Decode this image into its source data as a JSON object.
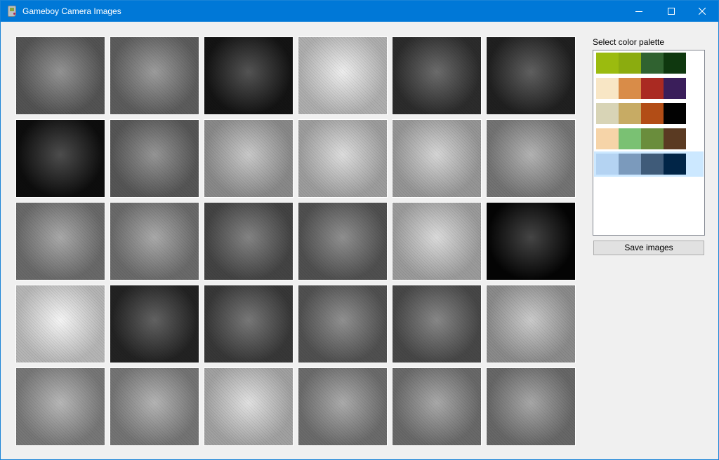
{
  "window": {
    "title": "Gameboy Camera Images"
  },
  "palette_panel": {
    "label": "Select color palette",
    "palettes": [
      {
        "colors": [
          "#9bbb0f",
          "#8bac0f",
          "#306230",
          "#0f380f"
        ],
        "selected": false
      },
      {
        "colors": [
          "#f8e6c5",
          "#d98c48",
          "#aa2a22",
          "#3a1e5a"
        ],
        "selected": false
      },
      {
        "colors": [
          "#d8d4b6",
          "#c7ab64",
          "#b24d16",
          "#020202"
        ],
        "selected": false
      },
      {
        "colors": [
          "#f6d4a8",
          "#7ac173",
          "#6a8d3c",
          "#5a3a22"
        ],
        "selected": false
      },
      {
        "colors": [
          "#b4d3f2",
          "#7b9abc",
          "#3f5b79",
          "#012547"
        ],
        "selected": true
      }
    ],
    "save_label": "Save images"
  },
  "images": [
    {
      "name": "tv-remote",
      "tone": "#6f6f6f"
    },
    {
      "name": "tv-empty",
      "tone": "#7b7b7b"
    },
    {
      "name": "graphic-stripes",
      "tone": "#1a1a1a"
    },
    {
      "name": "high-contrast-shape",
      "tone": "#e8e8e8"
    },
    {
      "name": "hallway-dark",
      "tone": "#3a3a3a"
    },
    {
      "name": "dark-door",
      "tone": "#2a2a2a"
    },
    {
      "name": "dark-scene",
      "tone": "#111111"
    },
    {
      "name": "tv-remote-2",
      "tone": "#727272"
    },
    {
      "name": "paper-drawing",
      "tone": "#b7b7b7"
    },
    {
      "name": "child-hallway",
      "tone": "#d2d2d2"
    },
    {
      "name": "child-arms-up",
      "tone": "#c8c8c8"
    },
    {
      "name": "boy-portrait",
      "tone": "#9a9a9a"
    },
    {
      "name": "woman-smiling",
      "tone": "#8c8c8c"
    },
    {
      "name": "boy-portrait-2",
      "tone": "#8d8d8d"
    },
    {
      "name": "gradient-curve",
      "tone": "#5a5a5a"
    },
    {
      "name": "child-closeup",
      "tone": "#6a6a6a"
    },
    {
      "name": "cables-toy",
      "tone": "#cfcfcf"
    },
    {
      "name": "black-noise",
      "tone": "#060606"
    },
    {
      "name": "cables-white",
      "tone": "#f2f2f2"
    },
    {
      "name": "screen-photo",
      "tone": "#2d2d2d"
    },
    {
      "name": "paper-on-floor",
      "tone": "#4a4a4a"
    },
    {
      "name": "girl-smiling",
      "tone": "#6b6b6b"
    },
    {
      "name": "two-faces",
      "tone": "#5f5f5f"
    },
    {
      "name": "face-upside-down",
      "tone": "#b9b9b9"
    },
    {
      "name": "face-grimace",
      "tone": "#9f9f9f"
    },
    {
      "name": "boy-lying",
      "tone": "#9b9b9b"
    },
    {
      "name": "face-closeup",
      "tone": "#d7d7d7"
    },
    {
      "name": "face-fisheye-1",
      "tone": "#8f8f8f"
    },
    {
      "name": "face-fisheye-2",
      "tone": "#8c8c8c"
    },
    {
      "name": "face-fisheye-3",
      "tone": "#8a8a8a"
    }
  ]
}
